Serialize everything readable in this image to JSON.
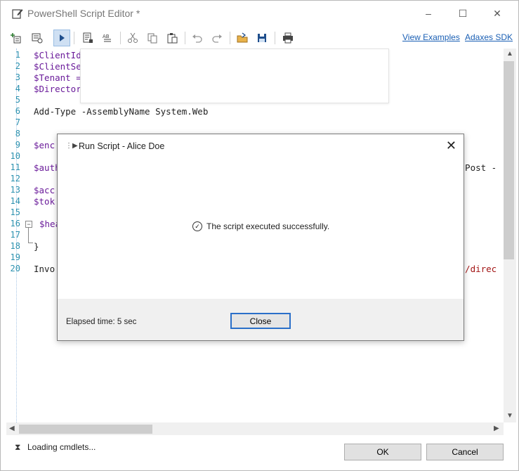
{
  "window": {
    "title": "PowerShell Script Editor *",
    "controls": {
      "minimize": "–",
      "maximize": "☐",
      "close": "✕"
    }
  },
  "toolbar": {
    "links": {
      "view_examples": "View Examples",
      "sdk": "Adaxes SDK"
    }
  },
  "editor": {
    "line_numbers": [
      "1",
      "2",
      "3",
      "4",
      "5",
      "6",
      "7",
      "8",
      "9",
      "10",
      "11",
      "12",
      "13",
      "14",
      "15",
      "16",
      "17",
      "18",
      "19",
      "20"
    ],
    "lines": {
      "l1": "$ClientId",
      "l2": "$ClientSe",
      "l3": "$Tenant =",
      "l4": "$Director",
      "l6": "Add-Type -AssemblyName System.Web",
      "l9": "$enc",
      "l11_a": "$auth",
      "l11_b": "d Post -",
      "l13": "$acc",
      "l14": "$tok",
      "l16": "$hea",
      "l18": "}",
      "l20_a": "Invo",
      "l20_b": "nt/direc"
    },
    "fold_marker": "−"
  },
  "status": {
    "icon": "hourglass-icon",
    "text": "Loading cmdlets..."
  },
  "buttons": {
    "ok": "OK",
    "cancel": "Cancel"
  },
  "dialog": {
    "title": "Run Script - Alice Doe",
    "message": "The script executed successfully.",
    "elapsed": "Elapsed time: 5 sec",
    "close_label": "Close"
  },
  "colors": {
    "accent": "#2a6fc9",
    "link": "#1a5fb4",
    "variable": "#6a1b9a",
    "line_number": "#2b91af"
  }
}
